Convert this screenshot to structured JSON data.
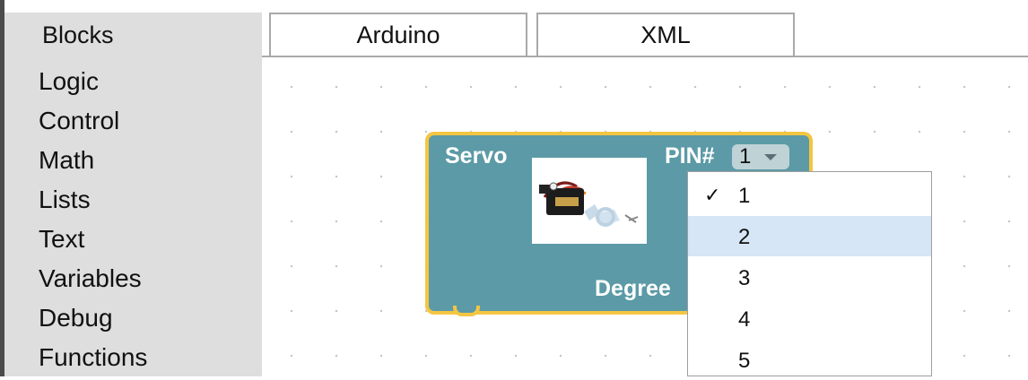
{
  "tabs": [
    {
      "label": "Blocks"
    },
    {
      "label": "Arduino"
    },
    {
      "label": "XML"
    }
  ],
  "toolbox": {
    "items": [
      "Logic",
      "Control",
      "Math",
      "Lists",
      "Text",
      "Variables",
      "Debug",
      "Functions"
    ]
  },
  "block": {
    "title": "Servo",
    "pin_label": "PIN#",
    "pin_value": "1",
    "degree_label": "Degree"
  },
  "dropdown": {
    "options": [
      "1",
      "2",
      "3",
      "4",
      "5"
    ],
    "selected": "1",
    "hovered": "2",
    "check_glyph": "✓"
  },
  "colors": {
    "block": "#5b9aa6",
    "block_highlight": "#f4c542",
    "hover": "#d6e6f6",
    "toolbox": "#dedede"
  }
}
